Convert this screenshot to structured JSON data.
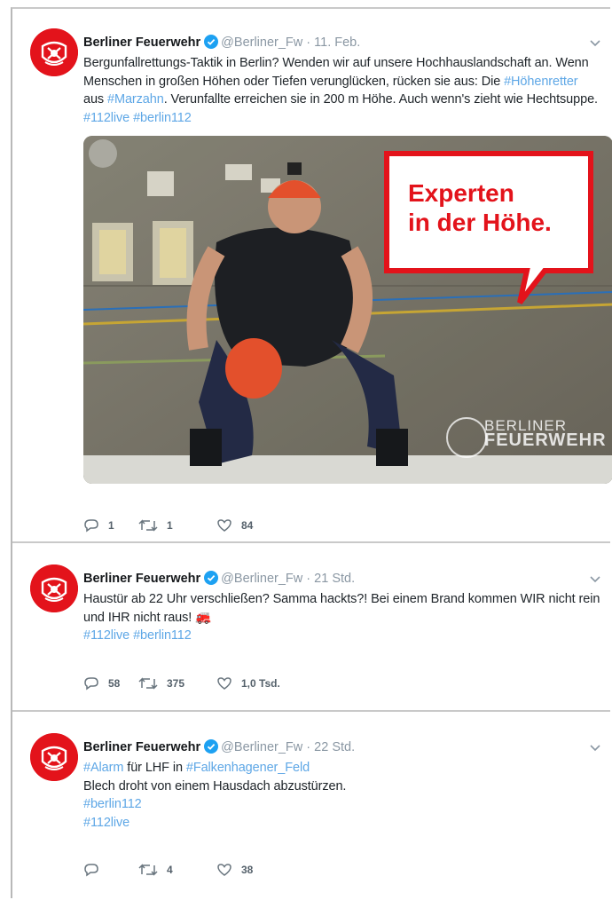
{
  "account": {
    "name": "Berliner Feuerwehr",
    "handle": "@Berliner_Fw",
    "separator": "·",
    "verified_color": "#1da1f2",
    "avatar_color": "#e3131b"
  },
  "tweets": [
    {
      "time": "11. Feb.",
      "text": [
        {
          "t": "Bergunfallrettungs-Taktik in Berlin? Wenden wir auf unsere Hochhauslandschaft an. Wenn Menschen in großen Höhen oder Tiefen verunglücken, rücken sie aus: Die ",
          "tag": false
        },
        {
          "t": "#Höhenretter",
          "tag": true
        },
        {
          "t": " aus ",
          "tag": false
        },
        {
          "t": "#Marzahn",
          "tag": true
        },
        {
          "t": ". Verunfallte erreichen sie in 200 m Höhe. Auch wenn's zieht wie Hechtsuppe. ",
          "tag": false
        },
        {
          "t": "#112live",
          "tag": true
        },
        {
          "t": " ",
          "tag": false
        },
        {
          "t": "#berlin112",
          "tag": true
        }
      ],
      "media": {
        "bubble_line1": "Experten",
        "bubble_line2": "in der Höhe.",
        "watermark_line1": "BERLINER",
        "watermark_line2": "FEUERWEHR"
      },
      "replies": "1",
      "retweets": "1",
      "likes": "84"
    },
    {
      "time": "21 Std.",
      "text": [
        {
          "t": "Haustür ab 22 Uhr verschließen? Samma hackts?! Bei einem Brand kommen WIR nicht rein und IHR nicht raus! ",
          "tag": false
        },
        {
          "t": "🚒",
          "tag": false
        },
        {
          "t": "\n",
          "tag": false
        },
        {
          "t": "#112live",
          "tag": true
        },
        {
          "t": " ",
          "tag": false
        },
        {
          "t": "#berlin112",
          "tag": true
        }
      ],
      "replies": "58",
      "retweets": "375",
      "likes": "1,0 Tsd."
    },
    {
      "time": "22 Std.",
      "text": [
        {
          "t": "#Alarm",
          "tag": true
        },
        {
          "t": " für LHF in ",
          "tag": false
        },
        {
          "t": "#Falkenhagener_Feld",
          "tag": true
        },
        {
          "t": "\nBlech droht von einem Hausdach abzustürzen.\n",
          "tag": false
        },
        {
          "t": "#berlin112",
          "tag": true
        },
        {
          "t": "\n",
          "tag": false
        },
        {
          "t": "#112live",
          "tag": true
        }
      ],
      "replies": "",
      "retweets": "4",
      "likes": "38"
    }
  ],
  "icons": {
    "reply": "reply-icon",
    "retweet": "retweet-icon",
    "like": "heart-icon",
    "menu": "chevron-down-icon",
    "verified": "verified-badge-icon"
  }
}
